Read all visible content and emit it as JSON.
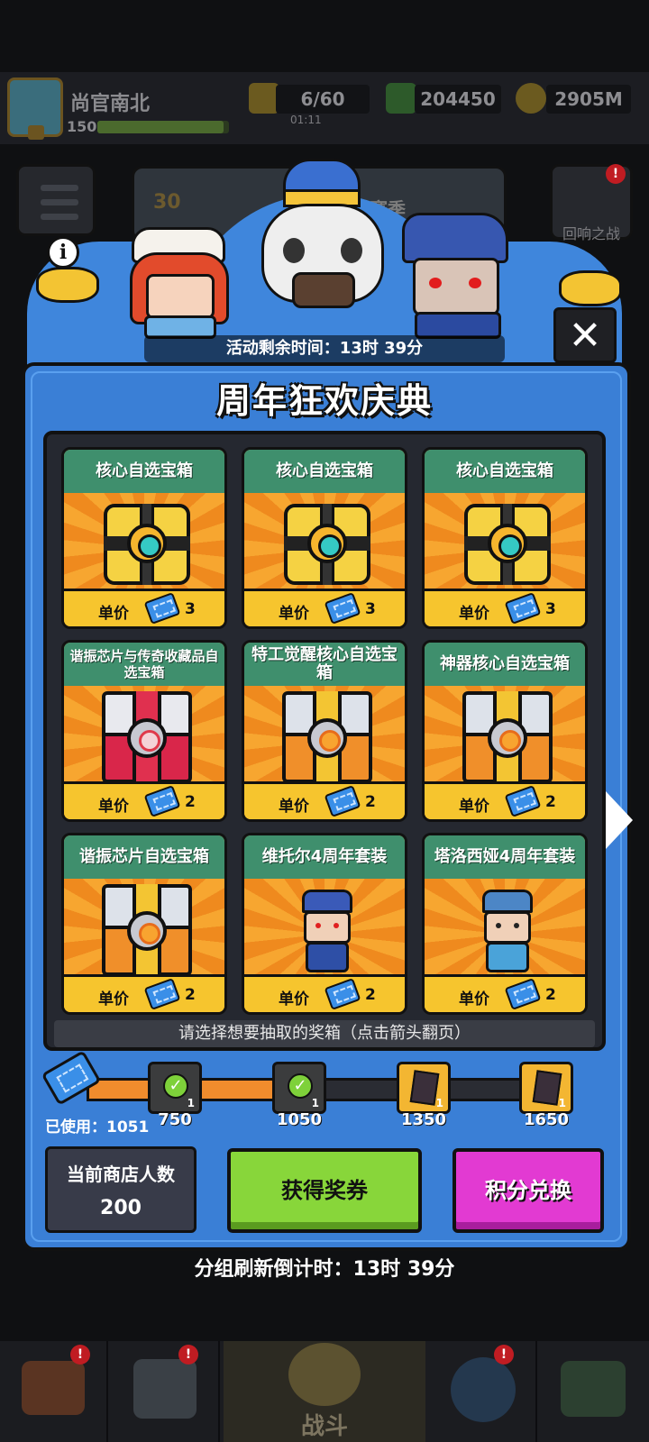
{
  "player": {
    "name": "尚官南北",
    "level": "150",
    "xp_fraction": 0.96
  },
  "resources": {
    "energy": "6/60",
    "energy_timer": "01:11",
    "gems": "204450",
    "gold": "2905M"
  },
  "background": {
    "season_level": "30",
    "season_label": "赛季",
    "echo_battle_label": "回响之战",
    "alert_mark": "!"
  },
  "event": {
    "remaining_time": "活动剩余时间：13时 39分",
    "title": "周年狂欢庆典",
    "info_icon": "i",
    "close_icon": "✕"
  },
  "price_label": "单价",
  "chests": [
    {
      "name": "核心自选宝箱",
      "price": "3",
      "art": "core"
    },
    {
      "name": "核心自选宝箱",
      "price": "3",
      "art": "core"
    },
    {
      "name": "核心自选宝箱",
      "price": "3",
      "art": "core"
    },
    {
      "name": "谐振芯片与传奇收藏品自选宝箱",
      "price": "2",
      "art": "red-chest"
    },
    {
      "name": "特工觉醒核心自选宝箱",
      "price": "2",
      "art": "orange-chest"
    },
    {
      "name": "神器核心自选宝箱",
      "price": "2",
      "art": "orange-chest"
    },
    {
      "name": "谐振芯片自选宝箱",
      "price": "2",
      "art": "orange-chest"
    },
    {
      "name": "维托尔4周年套装",
      "price": "2",
      "art": "character"
    },
    {
      "name": "塔洛西娅4周年套装",
      "price": "2",
      "art": "character"
    }
  ],
  "hint": "请选择想要抽取的奖箱（点击箭头翻页）",
  "progress": {
    "used_label": "已使用：1051",
    "used": 1051,
    "milestones": [
      {
        "value": "750",
        "count": "1",
        "claimed": true
      },
      {
        "value": "1050",
        "count": "1",
        "claimed": true
      },
      {
        "value": "1350",
        "count": "1",
        "claimed": false
      },
      {
        "value": "1650",
        "count": "1",
        "claimed": false
      }
    ]
  },
  "store": {
    "label": "当前商店人数",
    "count": "200"
  },
  "buttons": {
    "get_tickets": "获得奖券",
    "redeem": "积分兑换"
  },
  "refresh_countdown": "分组刷新倒计时：13时 39分",
  "nav": {
    "battle": "战斗"
  },
  "colors": {
    "panel_blue": "#3a7fd6",
    "card_header_green": "#3f8f6d",
    "get_button_green": "#88d63a",
    "redeem_button_magenta": "#e23ad2",
    "progress_orange": "#f08c2d"
  }
}
